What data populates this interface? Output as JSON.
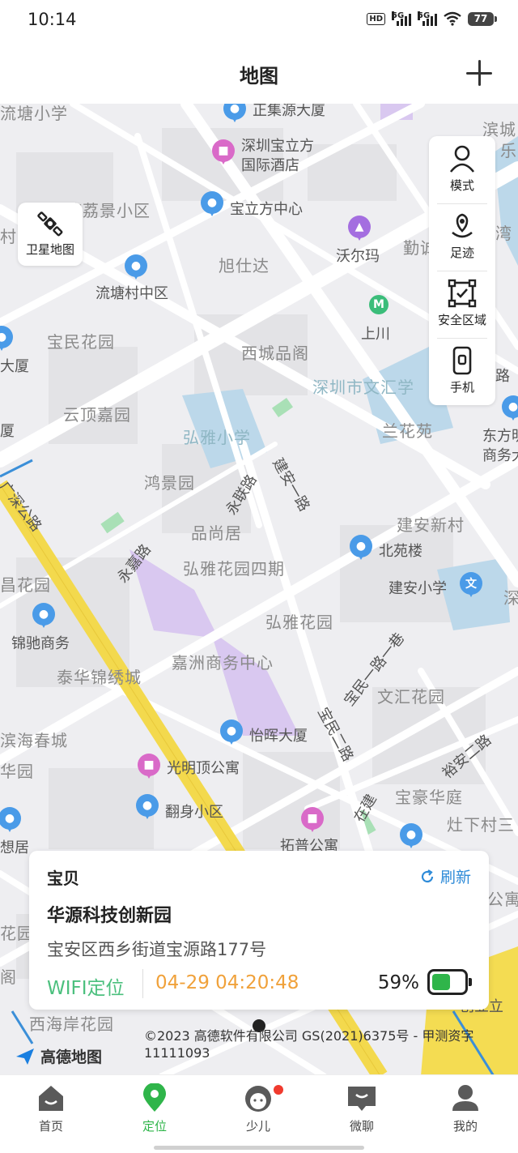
{
  "status_bar": {
    "time": "10:14",
    "hd_label": "HD",
    "signal1_label": "5G",
    "signal2_label": "5G",
    "battery": "77"
  },
  "header": {
    "title": "地图",
    "add_icon": "plus-icon"
  },
  "map": {
    "labels": {
      "l1": "流塘小学",
      "l2": "正集源大厦",
      "l3": "深圳宝立方",
      "l4": "国际酒店",
      "l5": "滨城",
      "l6": "乐",
      "l7": "流塘荔景小区",
      "l8": "宝立方中心",
      "l9": "村",
      "l10": "沃尔玛",
      "l11": "勤诚",
      "l12": "旭仕达",
      "l13": "流塘村中区",
      "l14": "上川",
      "l15": "宝民花园",
      "l16": "西城品阁",
      "l17": "大厦",
      "l18": "深圳市文汇学",
      "l19": "云顶嘉园",
      "l20": "弘雅小学",
      "l21": "兰花苑",
      "l22": "东方明",
      "l23": "商务大",
      "l24": "厦",
      "l25": "鸿景园",
      "l26": "永联路",
      "l27": "建安一路",
      "l28": "广深公路",
      "l29": "品尚居",
      "l30": "建安新村",
      "l31": "永嘉路",
      "l32": "北苑楼",
      "l33": "弘雅花园四期",
      "l34": "建安小学",
      "l35": "昌花园",
      "l36": "锦驰商务",
      "l37": "弘雅花园",
      "l38": "宝民一路一巷",
      "l39": "泰华锦绣城",
      "l40": "嘉洲商务中心",
      "l41": "文汇花园",
      "l42": "滨海春城",
      "l43": "怡晖大厦",
      "l44": "宝民二路",
      "l45": "裕安二路",
      "l46": "华园",
      "l47": "光明顶公寓",
      "l48": "宝豪华庭",
      "l49": "灶下村三",
      "l50": "翻身小区",
      "l51": "想居",
      "l52": "拓普公寓",
      "l53": "公寓",
      "l54": "花园",
      "l55": "西海岸花园",
      "l56": "创业立",
      "l57": "阁",
      "l58": "在建",
      "l59": "湾",
      "l60": "路",
      "l61": "深"
    }
  },
  "satellite_button": {
    "label": "卫星地图",
    "icon": "satellite-icon"
  },
  "tools": [
    {
      "label": "模式",
      "icon": "person-icon"
    },
    {
      "label": "足迹",
      "icon": "footprint-icon"
    },
    {
      "label": "安全区域",
      "icon": "safe-zone-icon"
    },
    {
      "label": "手机",
      "icon": "phone-icon"
    }
  ],
  "info_card": {
    "name": "宝贝",
    "refresh_label": "刷新",
    "place": "华源科技创新园",
    "address": "宝安区西乡街道宝源路177号",
    "location_type": "WIFI定位",
    "time": "04-29 04:20:48",
    "battery_pct": "59%",
    "battery_level": 0.59
  },
  "map_footer": {
    "copyright": "©2023 高德软件有限公司 GS(2021)6375号 - 甲测资字11111093",
    "logo_text": "高德地图"
  },
  "bottom_nav": [
    {
      "label": "首页",
      "icon": "home-icon",
      "active": false
    },
    {
      "label": "定位",
      "icon": "location-pin-icon",
      "active": true
    },
    {
      "label": "少儿",
      "icon": "kids-face-icon",
      "active": false
    },
    {
      "label": "微聊",
      "icon": "chat-icon",
      "active": false
    },
    {
      "label": "我的",
      "icon": "profile-icon",
      "active": false
    }
  ],
  "colors": {
    "accent_green": "#2fb54a",
    "refresh_blue": "#2e8bd8",
    "time_orange": "#f0a13a",
    "wifi_green": "#4cc07e"
  }
}
